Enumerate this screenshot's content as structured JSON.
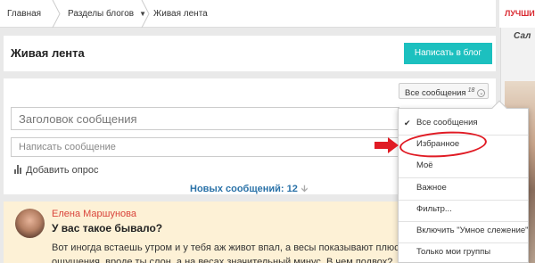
{
  "breadcrumb": {
    "home": "Главная",
    "sections": "Разделы блогов",
    "current": "Живая лента"
  },
  "right_banner": {
    "label": "ЛУЧШИЕ",
    "side_title": "Сал"
  },
  "header": {
    "title": "Живая лента",
    "write_button": "Написать в блог"
  },
  "compose": {
    "filter_label": "Все сообщения",
    "filter_count": "18",
    "title_placeholder": "Заголовок сообщения",
    "message_placeholder": "Написать сообщение",
    "add_poll": "Добавить опрос",
    "new_messages": "Новых сообщений: 12"
  },
  "post": {
    "author": "Елена Маршунова",
    "title": "У вас такое бывало?",
    "body_line1": "Вот иногда встаешь утром и у тебя аж живот впал, а весы показывают плюс...",
    "body_line2": "ощущения, вроде ты слон, а на весах значительный минус. В чем подвох?"
  },
  "dropdown": {
    "items": [
      {
        "label": "Все сообщения",
        "checked": true
      },
      {
        "label": "Избранное",
        "checked": false
      },
      {
        "label": "Моё",
        "checked": false
      },
      {
        "label": "Важное",
        "checked": false
      },
      {
        "label": "Фильтр...",
        "checked": false
      },
      {
        "label": "Включить \"Умное слежение\"",
        "checked": false
      },
      {
        "label": "Только мои группы",
        "checked": false
      }
    ]
  },
  "colors": {
    "accent": "#1cc0bf",
    "link": "#2a72a8",
    "author": "#d9443b",
    "highlight": "#e01b24",
    "post_bg": "#fdf1d6"
  }
}
